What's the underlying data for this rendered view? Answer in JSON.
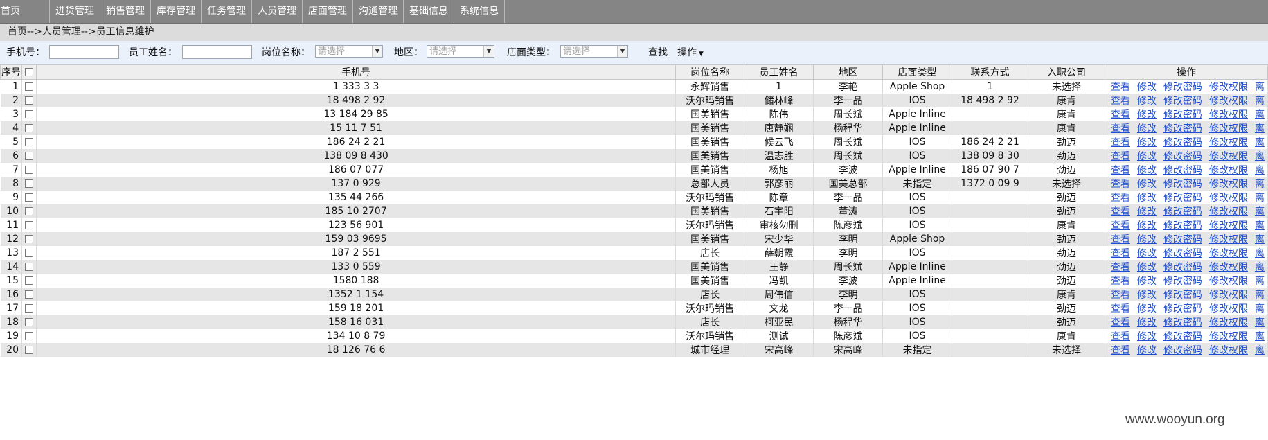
{
  "nav": [
    "首页",
    "进货管理",
    "销售管理",
    "库存管理",
    "任务管理",
    "人员管理",
    "店面管理",
    "沟通管理",
    "基础信息",
    "系统信息"
  ],
  "breadcrumb": "首页-->人员管理-->员工信息维护",
  "search": {
    "phone_label": "手机号：",
    "name_label": "员工姓名：",
    "post_label": "岗位名称：",
    "post_placeholder": "请选择",
    "area_label": "地区：",
    "area_placeholder": "请选择",
    "store_label": "店面类型：",
    "store_placeholder": "请选择",
    "find_button": "查找",
    "ops_button": "操作"
  },
  "table": {
    "headers": [
      "序号",
      "手机号",
      "岗位名称",
      "员工姓名",
      "地区",
      "店面类型",
      "联系方式",
      "入职公司",
      "操作"
    ],
    "actions": [
      "查看",
      "修改",
      "修改密码",
      "修改权限",
      "离"
    ],
    "rows": [
      {
        "no": "1",
        "phone": "1 333 3 3",
        "post": "永辉销售",
        "name": "1",
        "area": "李艳",
        "store": "Apple Shop",
        "contact": "1",
        "company": "未选择"
      },
      {
        "no": "2",
        "phone": "18 498 2 92",
        "post": "沃尔玛销售",
        "name": "储林峰",
        "area": "李一品",
        "store": "IOS",
        "contact": "18 498 2 92",
        "company": "康肯"
      },
      {
        "no": "3",
        "phone": "13 184 29 85",
        "post": "国美销售",
        "name": "陈伟",
        "area": "周长斌",
        "store": "Apple Inline",
        "contact": "",
        "company": "康肯"
      },
      {
        "no": "4",
        "phone": "15 11 7 51",
        "post": "国美销售",
        "name": "唐静娴",
        "area": "杨程华",
        "store": "Apple Inline",
        "contact": "",
        "company": "康肯"
      },
      {
        "no": "5",
        "phone": "186 24 2 21",
        "post": "国美销售",
        "name": "候云飞",
        "area": "周长斌",
        "store": "IOS",
        "contact": "186 24 2 21",
        "company": "劲迈"
      },
      {
        "no": "6",
        "phone": "138 09 8 430",
        "post": "国美销售",
        "name": "温志胜",
        "area": "周长斌",
        "store": "IOS",
        "contact": "138 09 8 30",
        "company": "劲迈"
      },
      {
        "no": "7",
        "phone": "186 07 077",
        "post": "国美销售",
        "name": "杨旭",
        "area": "李波",
        "store": "Apple Inline",
        "contact": "186 07 90 7",
        "company": "劲迈"
      },
      {
        "no": "8",
        "phone": "137 0 929",
        "post": "总部人员",
        "name": "郭彦丽",
        "area": "国美总部",
        "store": "未指定",
        "contact": "1372 0 09 9",
        "company": "未选择"
      },
      {
        "no": "9",
        "phone": "135 44 266",
        "post": "沃尔玛销售",
        "name": "陈章",
        "area": "李一品",
        "store": "IOS",
        "contact": "",
        "company": "劲迈"
      },
      {
        "no": "10",
        "phone": "185 10 2707",
        "post": "国美销售",
        "name": "石宇阳",
        "area": "董涛",
        "store": "IOS",
        "contact": "",
        "company": "劲迈"
      },
      {
        "no": "11",
        "phone": "123 56 901",
        "post": "沃尔玛销售",
        "name": "审核勿删",
        "area": "陈彦斌",
        "store": "IOS",
        "contact": "",
        "company": "康肯"
      },
      {
        "no": "12",
        "phone": "159 03 9695",
        "post": "国美销售",
        "name": "宋少华",
        "area": "李明",
        "store": "Apple Shop",
        "contact": "",
        "company": "劲迈"
      },
      {
        "no": "13",
        "phone": "187 2 551",
        "post": "店长",
        "name": "薛朝霞",
        "area": "李明",
        "store": "IOS",
        "contact": "",
        "company": "劲迈"
      },
      {
        "no": "14",
        "phone": "133 0 559",
        "post": "国美销售",
        "name": "王静",
        "area": "周长斌",
        "store": "Apple Inline",
        "contact": "",
        "company": "劲迈"
      },
      {
        "no": "15",
        "phone": "1580 188",
        "post": "国美销售",
        "name": "冯凯",
        "area": "李波",
        "store": "Apple Inline",
        "contact": "",
        "company": "劲迈"
      },
      {
        "no": "16",
        "phone": "1352 1 154",
        "post": "店长",
        "name": "周伟信",
        "area": "李明",
        "store": "IOS",
        "contact": "",
        "company": "康肯"
      },
      {
        "no": "17",
        "phone": "159 18 201",
        "post": "沃尔玛销售",
        "name": "文龙",
        "area": "李一品",
        "store": "IOS",
        "contact": "",
        "company": "劲迈"
      },
      {
        "no": "18",
        "phone": "158 16 031",
        "post": "店长",
        "name": "柯亚民",
        "area": "杨程华",
        "store": "IOS",
        "contact": "",
        "company": "劲迈"
      },
      {
        "no": "19",
        "phone": "134 10 8 79",
        "post": "沃尔玛销售",
        "name": "测试",
        "area": "陈彦斌",
        "store": "IOS",
        "contact": "",
        "company": "康肯"
      },
      {
        "no": "20",
        "phone": "18 126 76 6",
        "post": "城市经理",
        "name": "宋高峰",
        "area": "宋高峰",
        "store": "未指定",
        "contact": "",
        "company": "未选择"
      }
    ]
  },
  "watermark": "www.wooyun.org"
}
